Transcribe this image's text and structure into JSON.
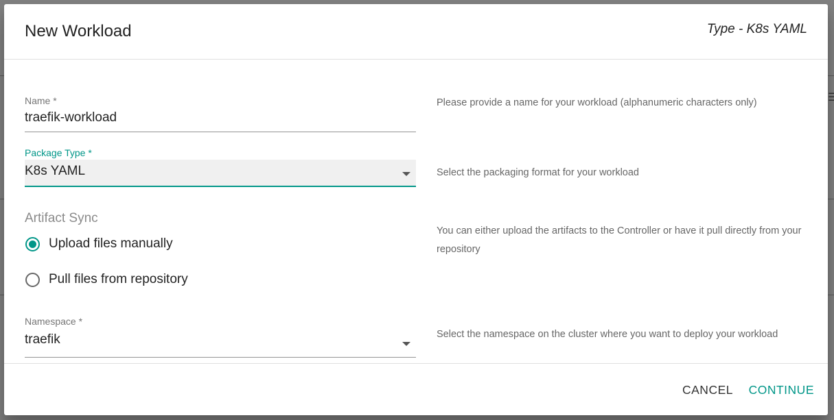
{
  "dialog": {
    "title": "New Workload",
    "subtitle": "Type - K8s YAML"
  },
  "fields": {
    "name": {
      "label": "Name *",
      "value": "traefik-workload",
      "help": "Please provide a name for your workload (alphanumeric characters only)"
    },
    "package_type": {
      "label": "Package Type *",
      "value": "K8s YAML",
      "help": "Select the packaging format for your workload"
    },
    "artifact_sync": {
      "title": "Artifact Sync",
      "options": [
        {
          "label": "Upload files manually",
          "selected": true
        },
        {
          "label": "Pull files from repository",
          "selected": false
        }
      ],
      "help": "You can either upload the artifacts to the Controller or have it pull directly from your repository"
    },
    "namespace": {
      "label": "Namespace *",
      "value": "traefik",
      "help": "Select the namespace on the cluster where you want to deploy your workload"
    }
  },
  "footer": {
    "cancel_label": "CANCEL",
    "continue_label": "CONTINUE"
  },
  "colors": {
    "accent": "#009688",
    "backdrop": "#808080"
  }
}
